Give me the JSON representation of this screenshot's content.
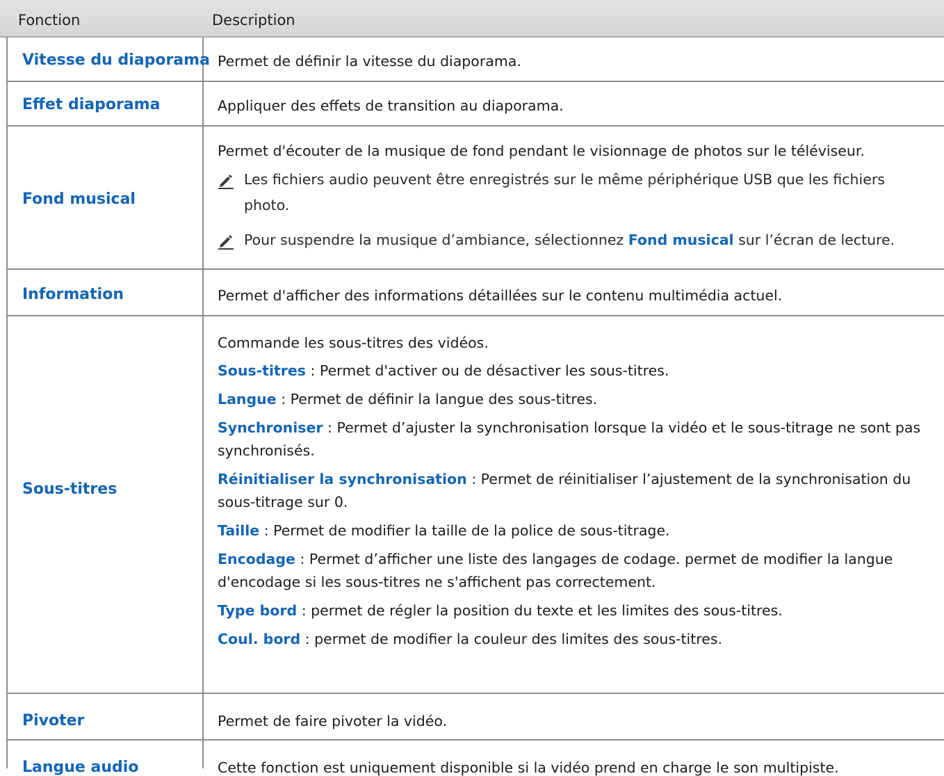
{
  "header": {
    "col1": "Fonction",
    "col2": "Description"
  },
  "rows": [
    {
      "name": "Vitesse du diaporama",
      "desc": "Permet de définir la vitesse du diaporama."
    },
    {
      "name": "Effet diaporama",
      "desc": "Appliquer des effets de transition au diaporama."
    },
    {
      "name": "Fond musical",
      "desc": "Permet d'écouter de la musique de fond pendant le visionnage de photos sur le téléviseur.",
      "note1_l1": "Les fichiers audio peuvent être enregistrés sur le même périphérique USB que les fichiers",
      "note1_l2": "photo.",
      "note2_pre": "Pour suspendre la musique d’ambiance, sélectionnez ",
      "note2_term": "Fond musical",
      "note2_post": " sur l’écran de lecture."
    },
    {
      "name": "Information",
      "desc": "Permet d'afficher des informations détaillées sur le contenu multimédia actuel."
    },
    {
      "name": "Sous-titres",
      "intro": "Commande les sous-titres des vidéos.",
      "items": [
        {
          "term": "Sous-titres",
          "text": " : Permet d'activer ou de désactiver les sous-titres."
        },
        {
          "term": "Langue",
          "text": " : Permet de définir la langue des sous-titres."
        },
        {
          "term": "Synchroniser",
          "text": " : Permet d’ajuster la synchronisation lorsque la vidéo et le sous-titrage ne sont pas",
          "cont": "synchronisés."
        },
        {
          "term": "Réinitialiser la synchronisation",
          "text": " : Permet de réinitialiser l’ajustement de la synchronisation du",
          "cont": "sous-titrage sur 0."
        },
        {
          "term": "Taille",
          "text": " : Permet de modifier la taille de la police de sous-titrage."
        },
        {
          "term": "Encodage",
          "text": " : Permet d’afficher une liste des langages de codage. permet de modifier la langue",
          "cont": "d'encodage si les sous-titres ne s'affichent pas correctement."
        },
        {
          "term": "Type bord",
          "text": " : permet de régler la position du texte et les limites des sous-titres."
        },
        {
          "term": "Coul. bord",
          "text": " : permet de modifier la couleur des limites des sous-titres."
        }
      ]
    },
    {
      "name": "Pivoter",
      "desc": "Permet de faire pivoter la vidéo."
    },
    {
      "name": "Langue audio",
      "desc": "Cette fonction est uniquement disponible si la vidéo prend en charge le son multipiste."
    }
  ],
  "colors": {
    "accent": "#1565b5",
    "border": "#8c8c8c",
    "header_bg": "#d6d6d6"
  },
  "icons": {
    "note": "pencil-note-icon"
  }
}
